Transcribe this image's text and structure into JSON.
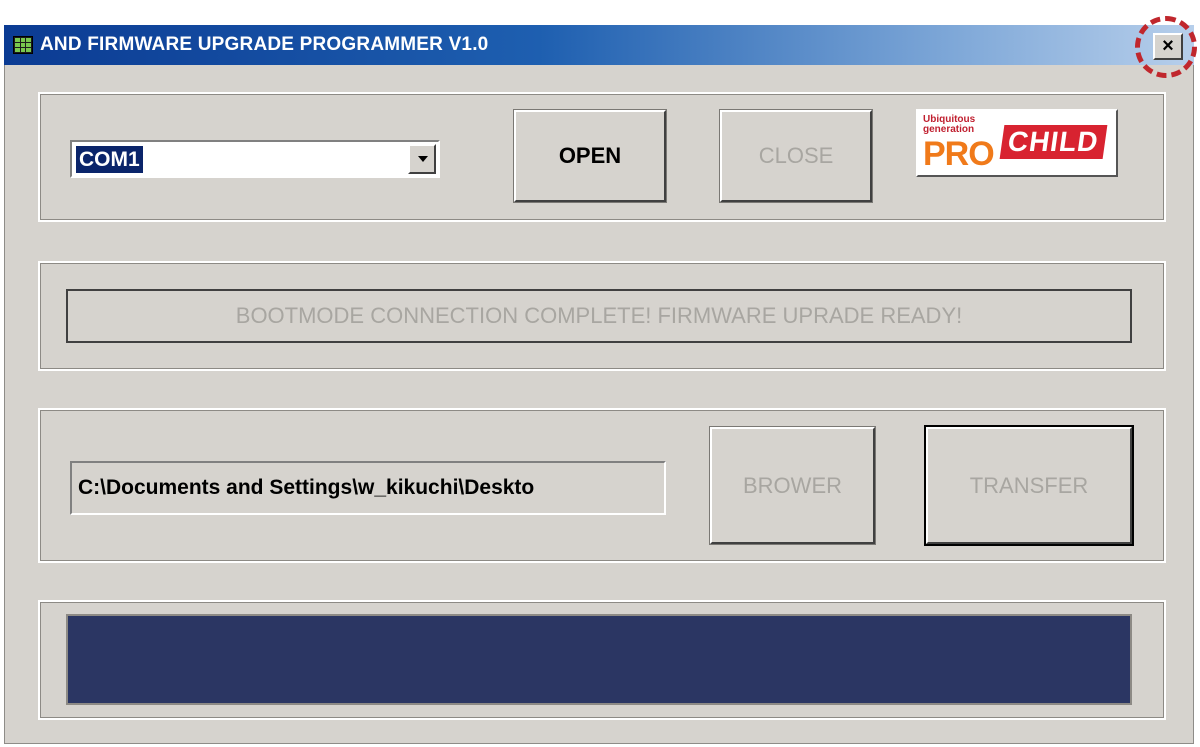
{
  "window": {
    "title": "AND FIRMWARE UPGRADE PROGRAMMER V1.0",
    "close_label": "×",
    "close_highlighted": true
  },
  "port": {
    "selected": "COM1",
    "open_label": "OPEN",
    "close_label": "CLOSE"
  },
  "logo": {
    "tagline": "Ubiquitous generation",
    "pro": "PRO",
    "child": "CHILD"
  },
  "status": {
    "message": "BOOTMODE CONNECTION COMPLETE! FIRMWARE UPRADE READY!"
  },
  "file": {
    "path": "C:\\Documents and Settings\\w_kikuchi\\Deskto",
    "browse_label": "BROWER",
    "transfer_label": "TRANSFER"
  },
  "progress": {
    "value": 1.0,
    "bar_color": "#2b3663"
  },
  "colors": {
    "window_bg": "#d6d3ce",
    "title_bar": "#0b3b93",
    "highlight": "#c0272d"
  }
}
